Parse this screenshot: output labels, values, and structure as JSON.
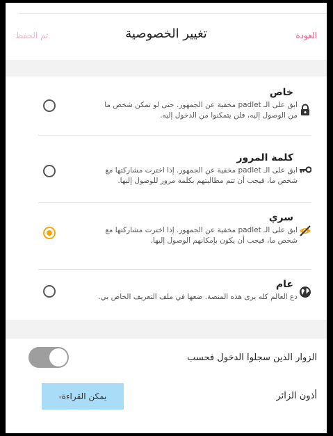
{
  "header": {
    "back_label": "العودة",
    "title": "تغيير الخصوصية",
    "done_label": "تم الحفظ"
  },
  "options": [
    {
      "title": "خاص",
      "icon": "lock-icon",
      "line1": "ابق على الـ padlet مخفية عن الجمهور. حتى لو تمكن شخص ما",
      "line2": "من الوصول إليه، فلن يتمكنوا من الدخول إليه.",
      "selected": false
    },
    {
      "title": "كلمة المرور",
      "icon": "key-icon",
      "line1": "ابق على الـ padlet مخفية عن الجمهور. إذا اخترت مشاركتها مع",
      "line2": "شخص ما، فيجب أن تتم مطالبتهم بكلمة مرور للوصول إليها.",
      "selected": false
    },
    {
      "title": "سري",
      "icon": "eye-off-icon",
      "line1": "ابق على الـ padlet مخفية عن الجمهور. إذا اخترت مشاركتها مع",
      "line2": "شخص ما، فيجب أن يكون بإمكانهم الوصول إليها.",
      "selected": true
    },
    {
      "title": "عام",
      "icon": "globe-icon",
      "line1": "دع العالم كله يرى هذه المنصة. ضعها في ملف التعريف الخاص بي.",
      "line2": "",
      "selected": false
    }
  ],
  "login_only": {
    "label": "الزوار الذين سجلوا الدخول فحسب",
    "enabled": true
  },
  "visitor_permissions": {
    "label": "أذون الزائر",
    "value": "يمكن القراءة",
    "caret": "▾"
  },
  "colors": {
    "accent": "#e9557f",
    "selected_radio": "#f5a70b",
    "button_bg": "#a8dcf7"
  }
}
